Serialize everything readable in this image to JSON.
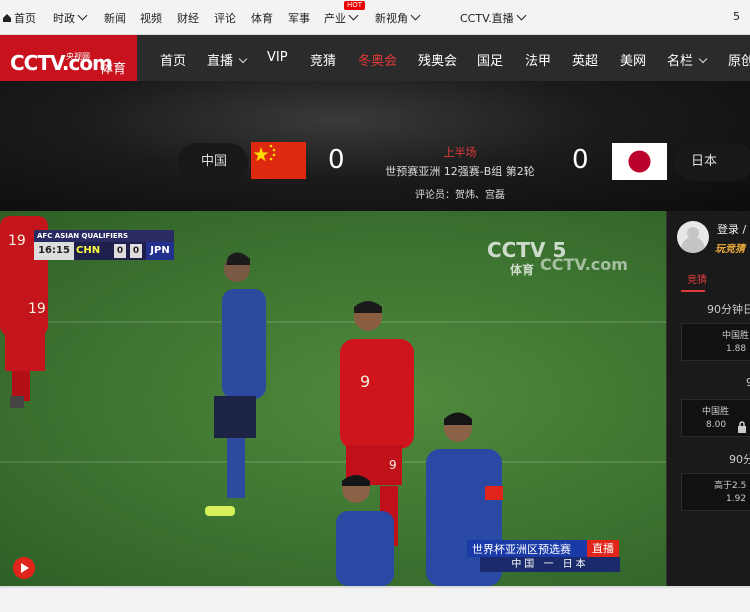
{
  "topbar": {
    "items": [
      "首页",
      "时政",
      "新闻",
      "视频",
      "财经",
      "评论",
      "体育",
      "军事",
      "产业",
      "新视角",
      "CCTV.直播"
    ],
    "hot_badge": "HOT",
    "right_text": "5"
  },
  "logo": {
    "main": "CCTV.com",
    "sub": "央视网",
    "section": "体育"
  },
  "nav": {
    "items": [
      "首页",
      "直播",
      "VIP",
      "竞猜",
      "冬奥会",
      "残奥会",
      "国足",
      "法甲",
      "英超",
      "美网",
      "名栏",
      "原创"
    ],
    "active": "冬奥会"
  },
  "match": {
    "home_team": "中国",
    "away_team": "日本",
    "home_score": "0",
    "away_score": "0",
    "period": "上半场",
    "competition": "世预赛亚洲 12强赛-B组 第2轮",
    "commentators": "评论员：贺炜、宫磊"
  },
  "video": {
    "scorebug": {
      "title": "AFC ASIAN QUALIFIERS",
      "time": "16:15",
      "home": "CHN",
      "home_score": "0",
      "away_score": "0",
      "away": "JPN"
    },
    "watermark_channel": "CCTV 5",
    "watermark_channel_sub": "体育",
    "watermark_site": "CCTV.com",
    "lower_third": {
      "title": "世界杯亚洲区预选赛",
      "live": "直播",
      "matchup": "中国 一 日本"
    },
    "jersey_numbers": [
      "19",
      "9",
      "9",
      "19"
    ]
  },
  "sidebar": {
    "login": "登录 /",
    "subtitle": "玩竞猜",
    "tab": "竞猜",
    "market1": "90分钟日",
    "bet1_label": "中国胜",
    "bet1_odds": "1.88",
    "market2": "9",
    "bet2_label": "中国胜",
    "bet2_odds": "8.00",
    "market3": "90分",
    "bet3_label": "高于2.5",
    "bet3_odds": "1.92"
  },
  "colors": {
    "accent": "#c8121e",
    "active_nav": "#e03a3a",
    "china_red": "#de2910",
    "japan_red": "#bc002d"
  }
}
